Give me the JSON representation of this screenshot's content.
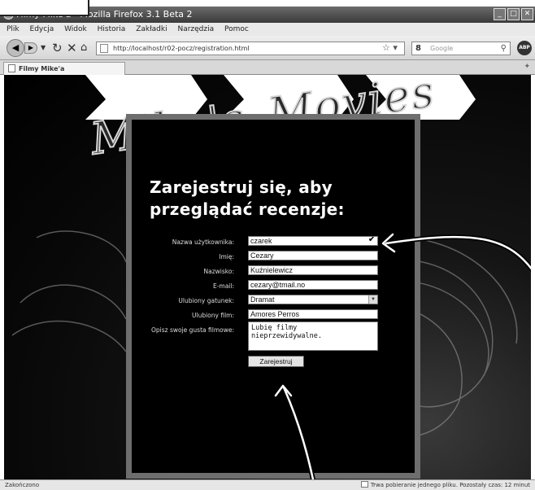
{
  "window": {
    "title": "Filmy Mike'a - Mozilla Firefox 3.1 Beta 2",
    "buttons": [
      "_",
      "□",
      "✕"
    ]
  },
  "menu": [
    "Plik",
    "Edycja",
    "Widok",
    "Historia",
    "Zakładki",
    "Narzędzia",
    "Pomoc"
  ],
  "nav": {
    "url": "http://localhost/r02-pocz/registration.html",
    "search_placeholder": "Google",
    "search_engine": "8",
    "addon": "ABP"
  },
  "tab": {
    "title": "Filmy Mike'a"
  },
  "site": {
    "logo_word1": "Mike's",
    "logo_word2": "Movies",
    "heading_line1": "Zarejestruj się, aby",
    "heading_line2": "przeglądać recenzje:"
  },
  "form": {
    "username": {
      "label": "Nazwa użytkownika:",
      "value": "czarek",
      "status": "valid"
    },
    "firstname": {
      "label": "Imię:",
      "value": "Cezary"
    },
    "lastname": {
      "label": "Nazwisko:",
      "value": "Kuźnielewicz"
    },
    "email": {
      "label": "E-mail:",
      "value": "cezary@tmail.no"
    },
    "genre": {
      "label": "Ulubiony gatunek:",
      "value": "Dramat"
    },
    "film": {
      "label": "Ulubiony film:",
      "value": "Amores Perros"
    },
    "taste": {
      "label": "Opisz swoje gusta filmowe:",
      "line1": "Lubię filmy",
      "line2": "nieprzewidywalne."
    },
    "submit_label": "Zarejestruj"
  },
  "status": {
    "left": "Zakończono",
    "right": "Trwa pobieranie jednego pliku. Pozostały czas: 12 minut"
  },
  "colors": {
    "panel_border": "#6e6e6e",
    "background": "#000000"
  }
}
